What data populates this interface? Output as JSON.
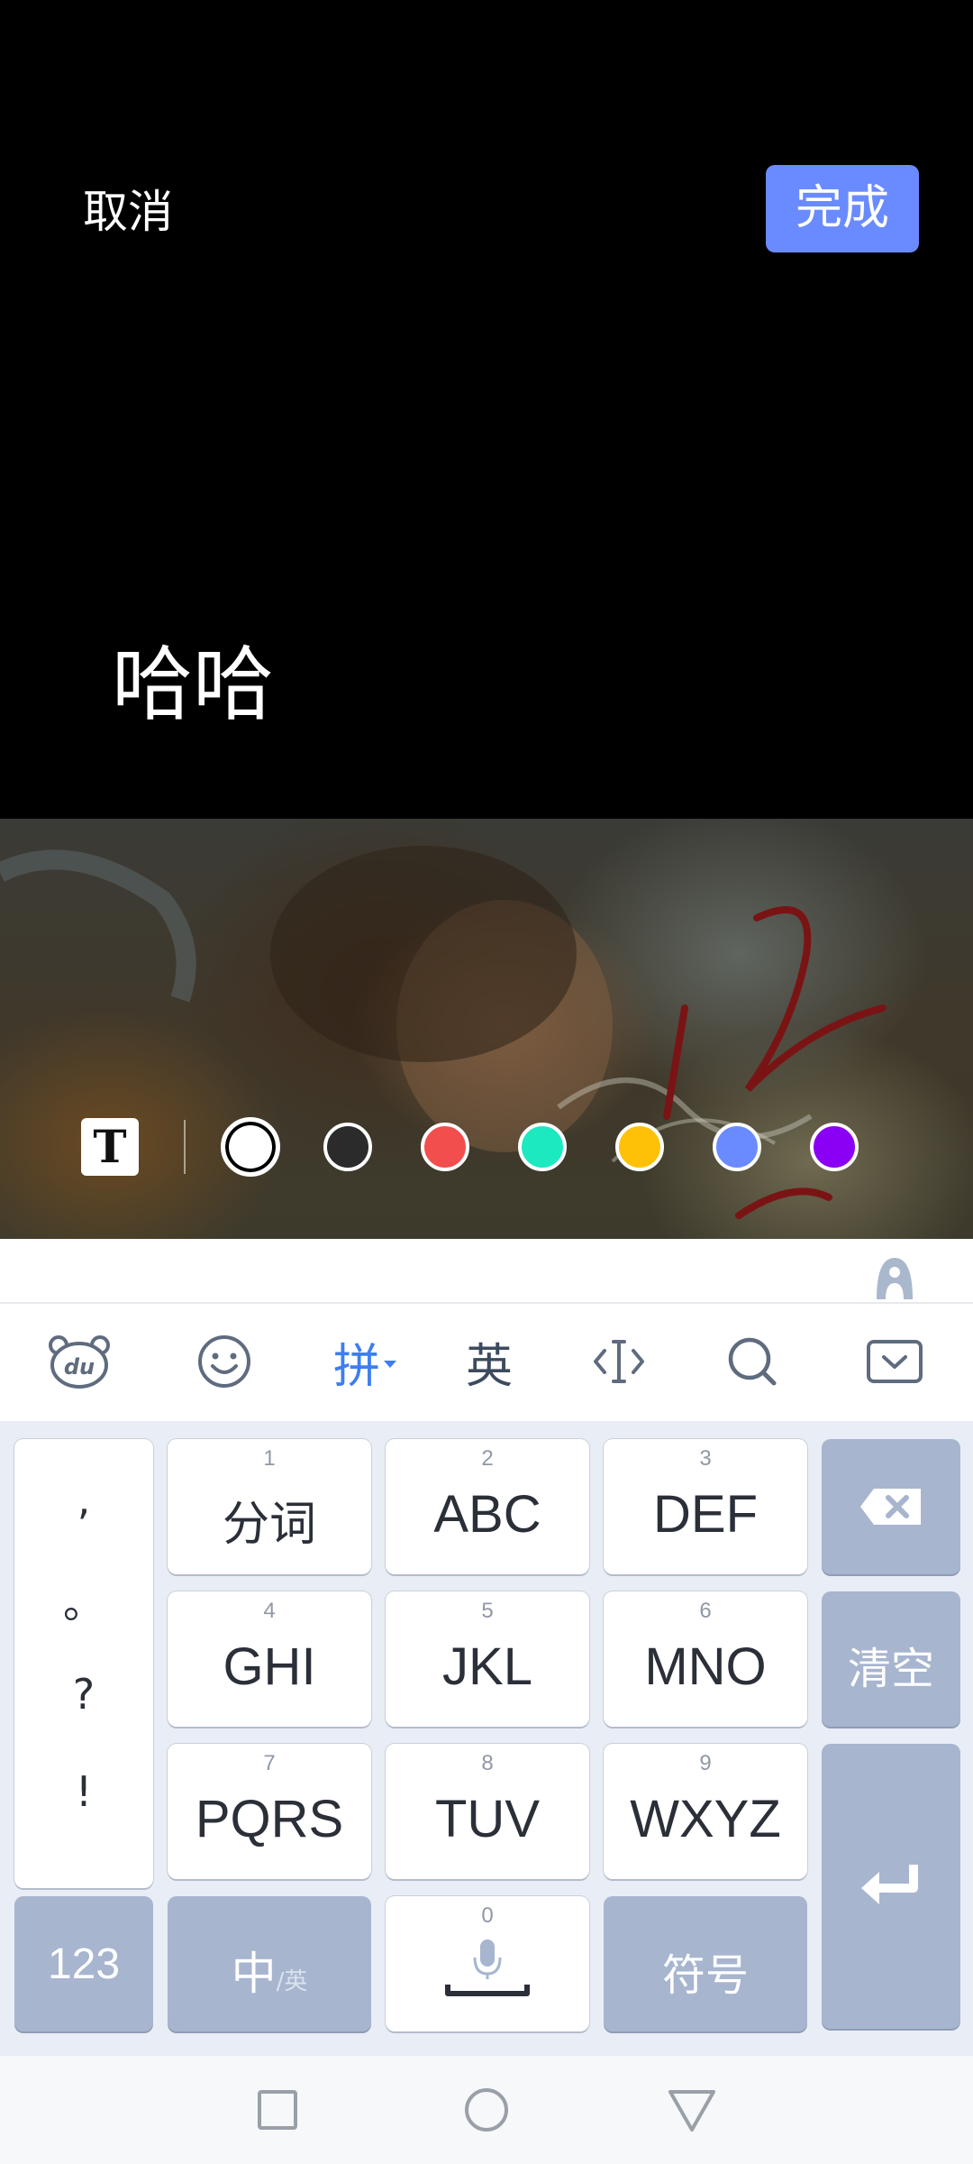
{
  "editor": {
    "cancel_label": "取消",
    "done_label": "完成",
    "text_content": "哈哈"
  },
  "colors": {
    "done_button": "#6a8bff",
    "active_ime": "#3d7ef0",
    "swatches": [
      "#ffffff",
      "#2b2b2b",
      "#f24e4e",
      "#1de9c0",
      "#ffc107",
      "#6a8bff",
      "#8a00f5"
    ]
  },
  "text_tool": {
    "glyph": "T",
    "icon": "text-style-icon"
  },
  "ime_toolbar": {
    "logo_text": "du",
    "pinyin_label": "拼",
    "english_label": "英",
    "icons": [
      "du-bear-logo-icon",
      "emoji-icon",
      "cursor-icon",
      "search-icon",
      "collapse-keyboard-icon"
    ]
  },
  "keys": {
    "punct": [
      ",",
      "。",
      "?",
      "!"
    ],
    "k1": {
      "num": "1",
      "label": "分词"
    },
    "k2": {
      "num": "2",
      "label": "ABC"
    },
    "k3": {
      "num": "3",
      "label": "DEF"
    },
    "k4": {
      "num": "4",
      "label": "GHI"
    },
    "k5": {
      "num": "5",
      "label": "JKL"
    },
    "k6": {
      "num": "6",
      "label": "MNO"
    },
    "k7": {
      "num": "7",
      "label": "PQRS"
    },
    "k8": {
      "num": "8",
      "label": "TUV"
    },
    "k9": {
      "num": "9",
      "label": "WXYZ"
    },
    "k0": {
      "num": "0"
    },
    "clear_label": "清空",
    "num_label": "123",
    "zh_label": "中",
    "en_sub_label": "/英",
    "symbol_label": "符号"
  }
}
